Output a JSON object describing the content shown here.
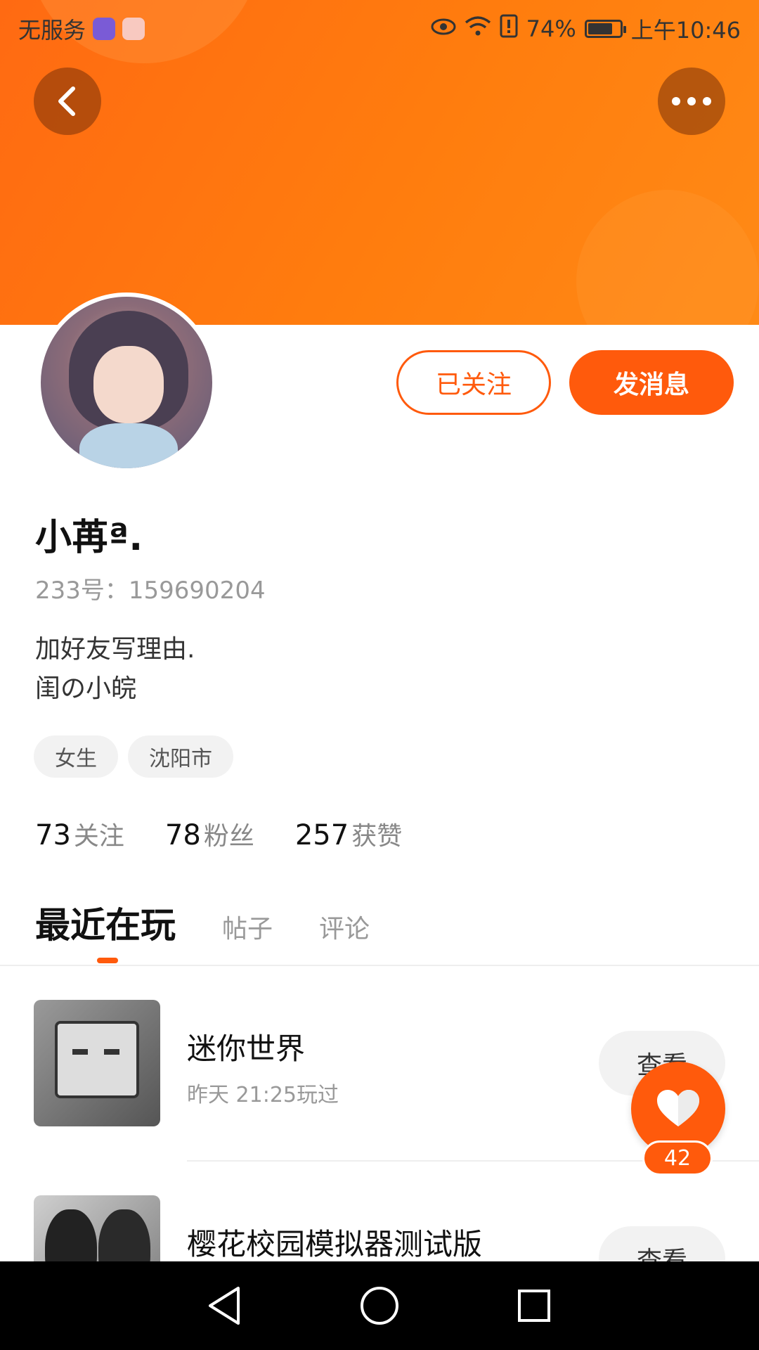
{
  "status_bar": {
    "carrier": "无服务",
    "battery_percent": "74%",
    "time": "上午10:46",
    "icons": [
      "eye-icon",
      "wifi-icon",
      "alert-icon",
      "battery-icon"
    ]
  },
  "header": {
    "back_icon": "chevron-left-icon",
    "more_icon": "more-dots-icon"
  },
  "profile": {
    "follow_label": "已关注",
    "message_label": "发消息",
    "nickname": "小苒ª.",
    "user_id": "233号：159690204",
    "bio_line1": "加好友写理由.",
    "bio_line2": "闺の小皖",
    "tags": [
      "女生",
      "沈阳市"
    ]
  },
  "stats": [
    {
      "num": "73",
      "label": "关注"
    },
    {
      "num": "78",
      "label": "粉丝"
    },
    {
      "num": "257",
      "label": "获赞"
    }
  ],
  "tabs": [
    "最近在玩",
    "帖子",
    "评论"
  ],
  "games": [
    {
      "title": "迷你世界",
      "time": "昨天 21:25玩过",
      "action": "查看"
    },
    {
      "title": "樱花校园模拟器测试版",
      "time": "",
      "action": "查看"
    }
  ],
  "like": {
    "count": "42",
    "color": "#ff5a0c"
  },
  "nav": [
    "back-nav-icon",
    "home-nav-icon",
    "recents-nav-icon"
  ]
}
